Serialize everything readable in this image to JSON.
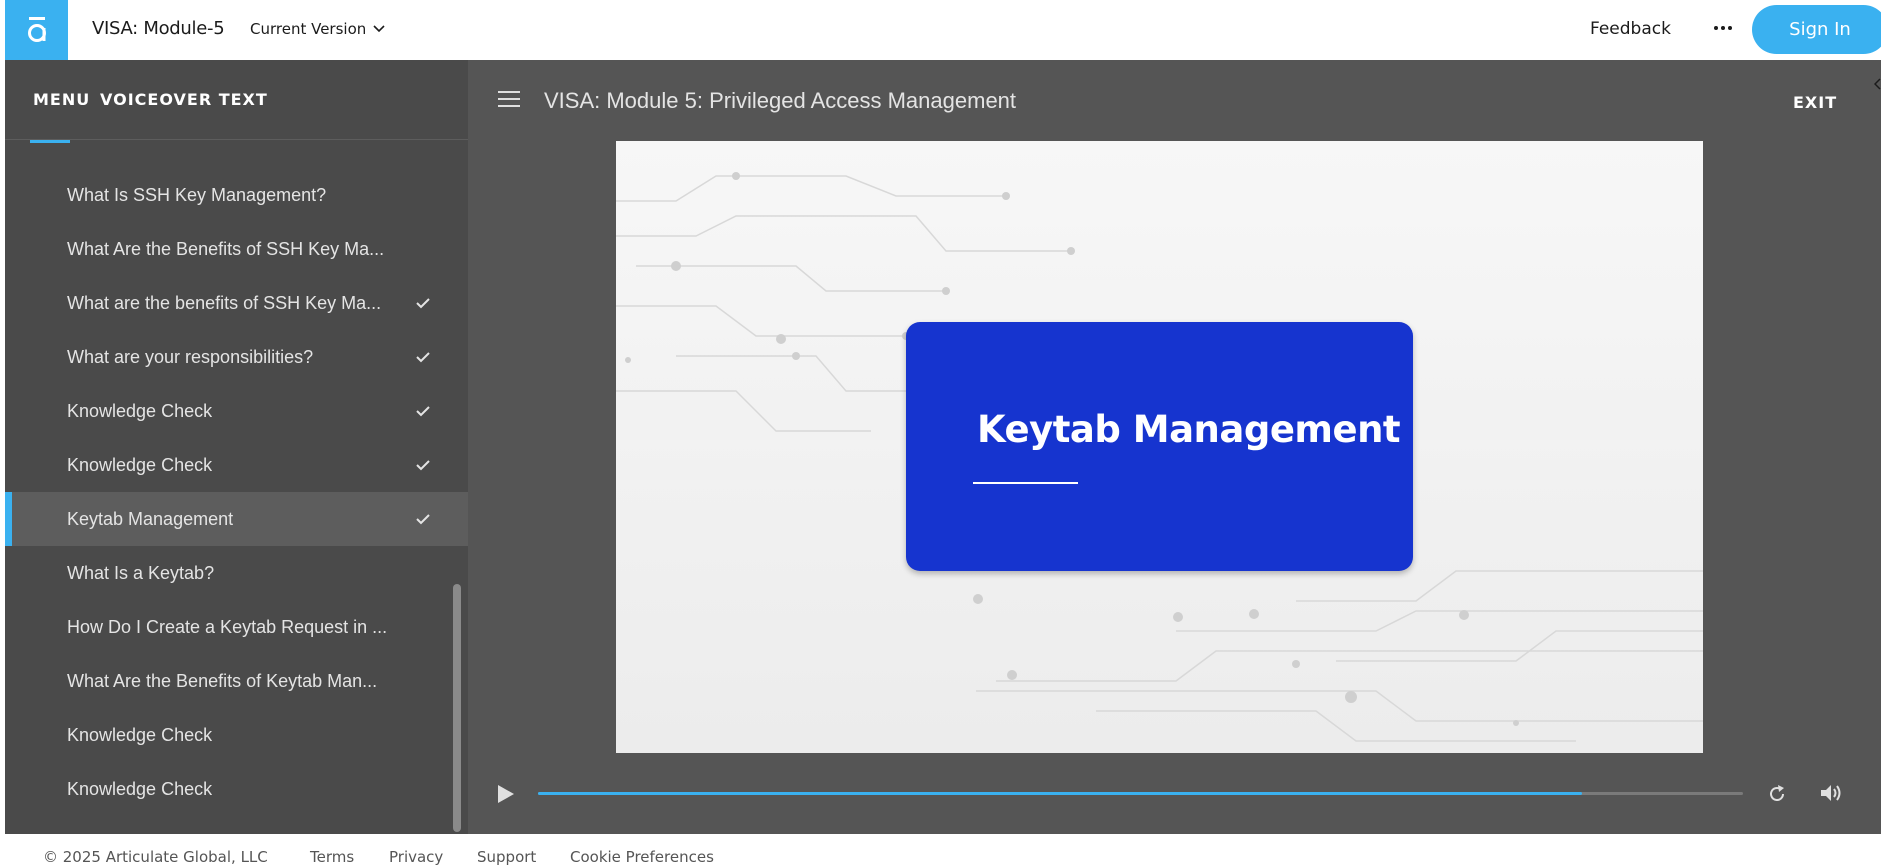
{
  "header": {
    "course_title": "VISA: Module-5",
    "version_label": "Current Version",
    "feedback_label": "Feedback",
    "signin_label": "Sign In"
  },
  "sidebar": {
    "tabs": {
      "menu": "MENU",
      "voiceover": "VOICEOVER TEXT"
    },
    "items": [
      {
        "label": "What Is SSH Key Management?",
        "checked": false
      },
      {
        "label": "What Are the Benefits of SSH Key Ma...",
        "checked": false
      },
      {
        "label": "What are the benefits of SSH Key Ma...",
        "checked": true
      },
      {
        "label": "What are your responsibilities?",
        "checked": true
      },
      {
        "label": "Knowledge Check",
        "checked": true
      },
      {
        "label": "Knowledge Check",
        "checked": true
      },
      {
        "label": "Keytab Management",
        "checked": true,
        "active": true
      },
      {
        "label": "What Is a Keytab?",
        "checked": false
      },
      {
        "label": "How Do I Create a Keytab Request in ...",
        "checked": false
      },
      {
        "label": "What Are the Benefits of Keytab Man...",
        "checked": false
      },
      {
        "label": "Knowledge Check",
        "checked": false
      },
      {
        "label": "Knowledge Check",
        "checked": false
      }
    ]
  },
  "content": {
    "lesson_title": "VISA: Module 5: Privileged Access Management",
    "exit_label": "EXIT",
    "slide": {
      "card_title": "Keytab Management",
      "card_color": "#1634cf"
    },
    "progress_fraction": 0.866
  },
  "footer": {
    "copyright": "© 2025 Articulate Global, LLC",
    "links": [
      "Terms",
      "Privacy",
      "Support",
      "Cookie Preferences"
    ]
  },
  "colors": {
    "accent": "#3ab1f0",
    "sidebar_bg": "#4a4a4a",
    "content_bg": "#555555"
  },
  "icons": {
    "logo": "articulate-logo-icon",
    "version_chevron": "chevron-down-icon",
    "more": "more-dots-icon",
    "menu": "hamburger-menu-icon",
    "check": "checkmark-icon",
    "play": "play-icon",
    "replay": "replay-icon",
    "volume": "volume-icon"
  }
}
